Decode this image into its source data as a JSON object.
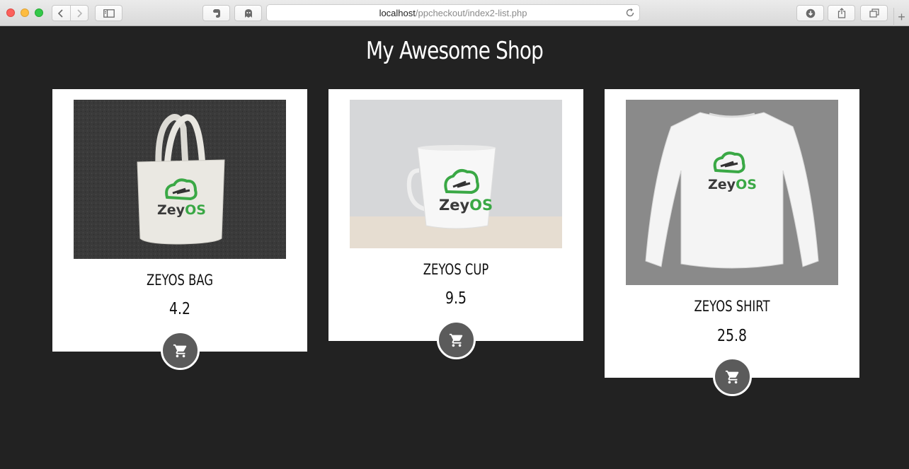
{
  "browser": {
    "url_host": "localhost",
    "url_path": "/ppcheckout/index2-list.php",
    "new_tab": "+"
  },
  "page": {
    "title": "My Awesome Shop"
  },
  "products": [
    {
      "name": "ZEYOS BAG",
      "price": "4.2",
      "image": "tote-bag-with-zeyos-logo"
    },
    {
      "name": "ZEYOS CUP",
      "price": "9.5",
      "image": "mug-with-zeyos-logo"
    },
    {
      "name": "ZEYOS SHIRT",
      "price": "25.8",
      "image": "long-sleeve-shirt-with-zeyos-logo"
    }
  ],
  "logo": {
    "text_dark": "Zey",
    "text_green": "OS"
  },
  "colors": {
    "background": "#222222",
    "card": "#ffffff",
    "cart_button": "#5b5b5b",
    "brand_green": "#3aa845"
  },
  "icons": {
    "cart": "shopping-cart-icon"
  }
}
